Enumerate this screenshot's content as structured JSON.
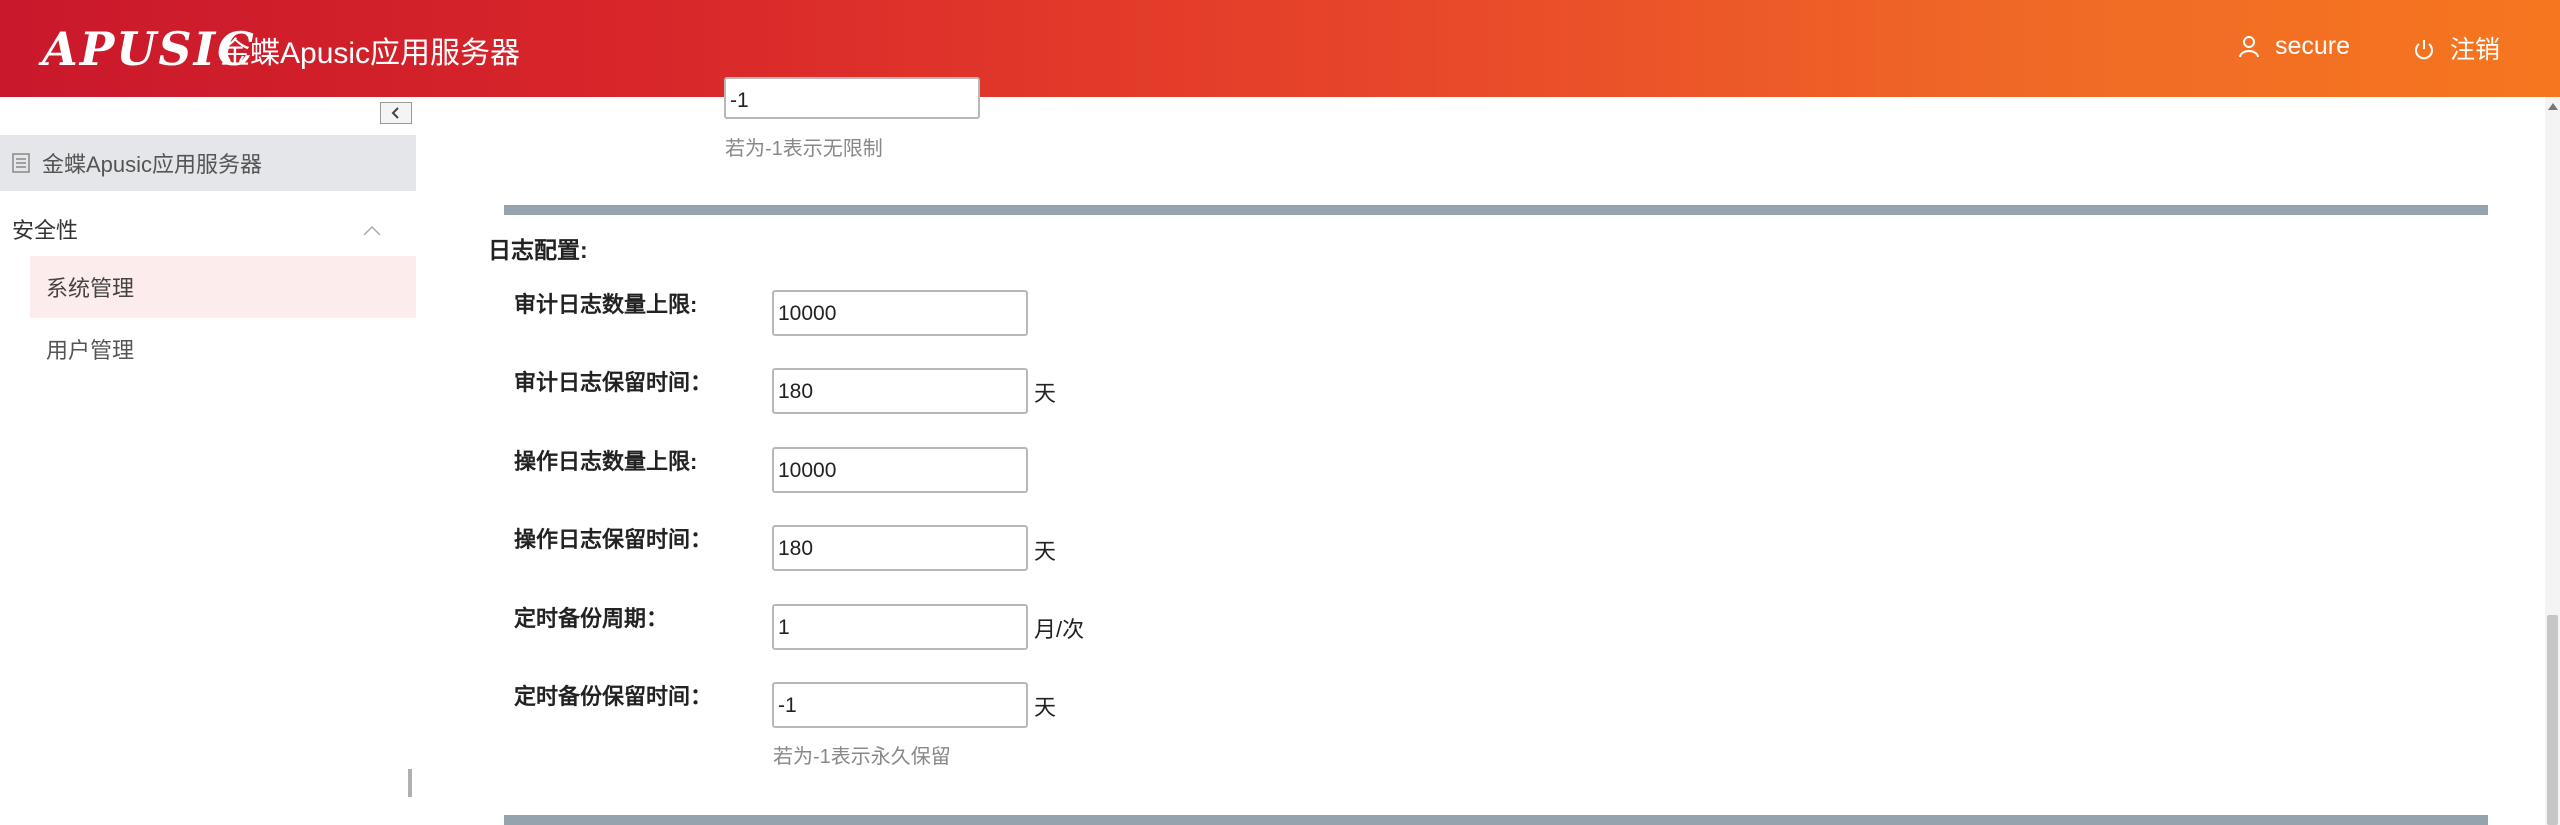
{
  "header": {
    "logo_text": "APUSIC",
    "app_title": "金蝶Apusic应用服务器",
    "user_name": "secure",
    "logout_label": "注销"
  },
  "sidebar": {
    "root_label": "金蝶Apusic应用服务器",
    "group_label": "安全性",
    "items": [
      {
        "label": "系统管理",
        "active": true
      },
      {
        "label": "用户管理",
        "active": false
      }
    ]
  },
  "main": {
    "top_partial": {
      "input_value": "-1",
      "hint": "若为-1表示无限制"
    },
    "log_section": {
      "title": "日志配置:",
      "fields": [
        {
          "label": "审计日志数量上限:",
          "value": "10000",
          "unit": ""
        },
        {
          "label": "审计日志保留时间：",
          "value": "180",
          "unit": "天"
        },
        {
          "label": "操作日志数量上限:",
          "value": "10000",
          "unit": ""
        },
        {
          "label": "操作日志保留时间：",
          "value": "180",
          "unit": "天"
        },
        {
          "label": "定时备份周期：",
          "value": "1",
          "unit": "月/次"
        },
        {
          "label": "定时备份保留时间：",
          "value": "-1",
          "unit": "天"
        }
      ],
      "hint": "若为-1表示永久保留"
    }
  },
  "colors": {
    "header_start": "#c9182b",
    "header_end": "#f6761f",
    "active_item_bg": "#fdecec",
    "section_bar": "#94a3ad"
  }
}
